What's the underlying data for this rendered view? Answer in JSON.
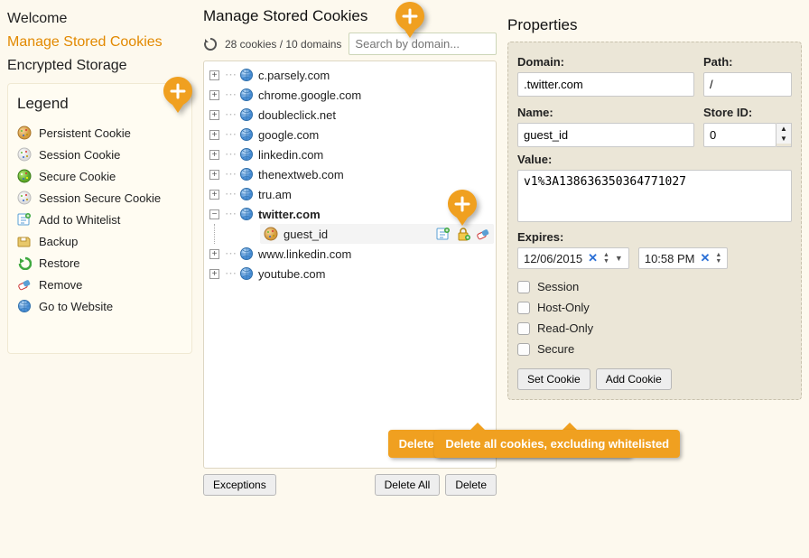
{
  "nav": {
    "welcome": "Welcome",
    "manage": "Manage Stored Cookies",
    "encrypted": "Encrypted Storage"
  },
  "legend": {
    "title": "Legend",
    "persistent": "Persistent Cookie",
    "session": "Session Cookie",
    "secure": "Secure Cookie",
    "session_secure": "Session Secure Cookie",
    "whitelist": "Add to Whitelist",
    "backup": "Backup",
    "restore": "Restore",
    "remove": "Remove",
    "goto": "Go to Website"
  },
  "mid": {
    "title": "Manage Stored Cookies",
    "count": "28 cookies / 10 domains",
    "search_placeholder": "Search by domain...",
    "domains": [
      "c.parsely.com",
      "chrome.google.com",
      "doubleclick.net",
      "google.com",
      "linkedin.com",
      "thenextweb.com",
      "tru.am",
      "twitter.com",
      "www.linkedin.com",
      "youtube.com"
    ],
    "expanded_index": 7,
    "expanded_cookie": "guest_id",
    "exceptions_btn": "Exceptions",
    "delete_all_btn": "Delete All",
    "delete_btn": "Delete",
    "tip_delete_all": "Delete all cookies, including whitelisted",
    "tip_delete": "Delete all cookies, excluding whitelisted"
  },
  "props": {
    "title": "Properties",
    "domain_label": "Domain:",
    "domain": ".twitter.com",
    "path_label": "Path:",
    "path": "/",
    "name_label": "Name:",
    "name": "guest_id",
    "store_label": "Store ID:",
    "store_id": "0",
    "value_label": "Value:",
    "value": "v1%3A138636350364771027",
    "expires_label": "Expires:",
    "expires_date": "12/06/2015",
    "expires_time": "10:58 PM",
    "session": "Session",
    "host_only": "Host-Only",
    "read_only": "Read-Only",
    "secure": "Secure",
    "set_cookie_btn": "Set Cookie",
    "add_cookie_btn": "Add Cookie"
  }
}
